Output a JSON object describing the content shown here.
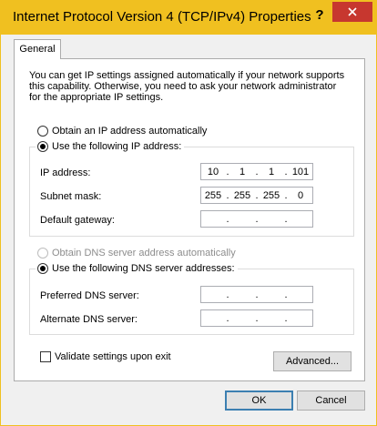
{
  "window": {
    "title": "Internet Protocol Version 4 (TCP/IPv4) Properties",
    "help_glyph": "?",
    "icons": {
      "close": "close-icon"
    }
  },
  "tabs": [
    {
      "label": "General",
      "selected": true
    }
  ],
  "general": {
    "intro": "You can get IP settings assigned automatically if your network supports this capability. Otherwise, you need to ask your network administrator for the appropriate IP settings.",
    "ip_mode": {
      "auto_label": "Obtain an IP address automatically",
      "manual_label": "Use the following IP address:",
      "selected": "manual"
    },
    "ip_fields": {
      "ip_label": "IP address:",
      "ip_value": [
        "10",
        "1",
        "1",
        "101"
      ],
      "subnet_label": "Subnet mask:",
      "subnet_value": [
        "255",
        "255",
        "255",
        "0"
      ],
      "gateway_label": "Default gateway:",
      "gateway_value": [
        "",
        "",
        "",
        ""
      ]
    },
    "dns_mode": {
      "auto_label": "Obtain DNS server address automatically",
      "auto_disabled": true,
      "manual_label": "Use the following DNS server addresses:",
      "selected": "manual"
    },
    "dns_fields": {
      "preferred_label": "Preferred DNS server:",
      "preferred_value": [
        "",
        "",
        "",
        ""
      ],
      "alternate_label": "Alternate DNS server:",
      "alternate_value": [
        "",
        "",
        "",
        ""
      ]
    },
    "validate": {
      "label": "Validate settings upon exit",
      "checked": false
    },
    "advanced_button": "Advanced..."
  },
  "footer": {
    "ok": "OK",
    "cancel": "Cancel"
  },
  "colors": {
    "titlebar": "#f0c020",
    "close_button": "#c7372f"
  }
}
